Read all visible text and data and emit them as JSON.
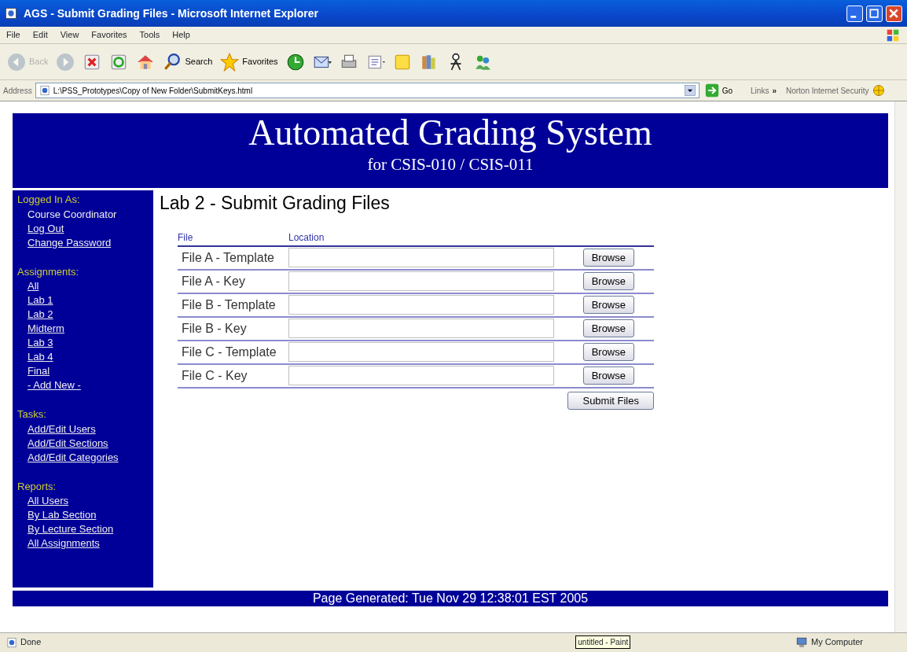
{
  "window": {
    "title": "AGS - Submit Grading Files - Microsoft Internet Explorer"
  },
  "menu": [
    "File",
    "Edit",
    "View",
    "Favorites",
    "Tools",
    "Help"
  ],
  "toolbar": [
    {
      "kind": "back",
      "label": "Back",
      "disabled": true
    },
    {
      "kind": "forward",
      "disabled": true
    },
    {
      "kind": "stop",
      "disabled": false
    },
    {
      "kind": "refresh",
      "disabled": false
    },
    {
      "kind": "home",
      "disabled": false
    },
    {
      "kind": "search",
      "label": "Search",
      "disabled": false
    },
    {
      "kind": "favorites",
      "label": "Favorites",
      "disabled": false
    },
    {
      "kind": "history",
      "disabled": false
    },
    {
      "kind": "mail",
      "disabled": false
    },
    {
      "kind": "print",
      "disabled": false
    },
    {
      "kind": "edit",
      "disabled": false
    },
    {
      "kind": "note",
      "disabled": false
    },
    {
      "kind": "research",
      "disabled": false
    },
    {
      "kind": "person",
      "disabled": false
    },
    {
      "kind": "messenger",
      "disabled": false
    }
  ],
  "address_bar": {
    "label": "Address",
    "url": "L:\\PSS_Prototypes\\Copy of New Folder\\SubmitKeys.html",
    "go": "Go",
    "links": "Links",
    "more": "»",
    "norton": "Norton Internet Security"
  },
  "header": {
    "title": "Automated Grading System",
    "subtitle": "for CSIS-010 / CSIS-011"
  },
  "sidebar": {
    "sections": [
      {
        "heading": "Logged In As:",
        "items": [
          {
            "kind": "text",
            "label": "Course Coordinator"
          },
          {
            "kind": "link",
            "label": "Log Out"
          },
          {
            "kind": "link",
            "label": "Change Password"
          }
        ]
      },
      {
        "heading": "Assignments:",
        "items": [
          {
            "kind": "link",
            "label": "All"
          },
          {
            "kind": "link",
            "label": "Lab 1"
          },
          {
            "kind": "link",
            "label": "Lab 2"
          },
          {
            "kind": "link",
            "label": "Midterm"
          },
          {
            "kind": "link",
            "label": "Lab 3"
          },
          {
            "kind": "link",
            "label": "Lab 4"
          },
          {
            "kind": "link",
            "label": "Final"
          },
          {
            "kind": "link",
            "label": "- Add New -"
          }
        ]
      },
      {
        "heading": "Tasks:",
        "items": [
          {
            "kind": "link",
            "label": "Add/Edit Users"
          },
          {
            "kind": "link",
            "label": "Add/Edit Sections"
          },
          {
            "kind": "link",
            "label": "Add/Edit Categories"
          }
        ]
      },
      {
        "heading": "Reports:",
        "items": [
          {
            "kind": "link",
            "label": "All Users"
          },
          {
            "kind": "link",
            "label": "By Lab Section"
          },
          {
            "kind": "link",
            "label": "By Lecture Section"
          },
          {
            "kind": "link",
            "label": "All Assignments"
          }
        ]
      }
    ]
  },
  "main": {
    "heading": "Lab 2 - Submit Grading Files",
    "table": {
      "columns": [
        "File",
        "Location"
      ],
      "rows": [
        {
          "file": "File A - Template",
          "button": "Browse"
        },
        {
          "file": "File A - Key",
          "button": "Browse"
        },
        {
          "file": "File B - Template",
          "button": "Browse"
        },
        {
          "file": "File B - Key",
          "button": "Browse"
        },
        {
          "file": "File C - Template",
          "button": "Browse"
        },
        {
          "file": "File C - Key",
          "button": "Browse"
        }
      ]
    },
    "submit": "Submit Files"
  },
  "footer": "Page Generated: Tue Nov 29 12:38:01 EST 2005",
  "status_bar": {
    "status": "Done",
    "tooltip": "untitled - Paint",
    "zone": "My Computer"
  }
}
